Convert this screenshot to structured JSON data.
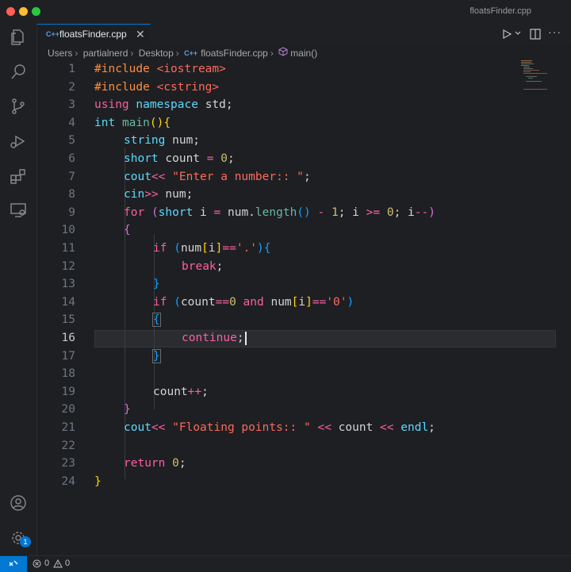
{
  "window": {
    "title": "floatsFinder.cpp"
  },
  "tab": {
    "icon_label": "C++",
    "name": "floatsFinder.cpp"
  },
  "breadcrumb": {
    "parts": [
      "Users",
      "partialnerd",
      "Desktop"
    ],
    "file_icon": "C++",
    "file": "floatsFinder.cpp",
    "symbol": "main()"
  },
  "editor": {
    "active_line": 16,
    "line_numbers": [
      "1",
      "2",
      "3",
      "4",
      "5",
      "6",
      "7",
      "8",
      "9",
      "10",
      "11",
      "12",
      "13",
      "14",
      "15",
      "16",
      "17",
      "18",
      "19",
      "20",
      "21",
      "22",
      "23",
      "24"
    ]
  },
  "code": {
    "l1": [
      "#include",
      " ",
      "<iostream>"
    ],
    "l2": [
      "#include",
      " ",
      "<cstring>"
    ],
    "l3": [
      "using",
      " ",
      "namespace",
      " std;"
    ],
    "l4": [
      "int",
      " ",
      "main",
      "()",
      "{"
    ],
    "l5": [
      "string",
      " num;"
    ],
    "l6": [
      "short",
      " count ",
      "=",
      " ",
      "0",
      ";"
    ],
    "l7": [
      "cout",
      "<<",
      " ",
      "\"Enter a number:: \"",
      ";"
    ],
    "l8": [
      "cin",
      ">>",
      " num;"
    ],
    "l9": [
      "for",
      " ",
      "(",
      "short",
      " i ",
      "=",
      " num.",
      "length",
      "()",
      " ",
      "-",
      " ",
      "1",
      "; i ",
      ">=",
      " ",
      "0",
      "; i",
      "--",
      ")"
    ],
    "l10": [
      "{"
    ],
    "l11": [
      "if",
      " ",
      "(",
      "num",
      "[",
      "i",
      "]",
      "==",
      "'.'",
      ")",
      "{"
    ],
    "l12": [
      "break",
      ";"
    ],
    "l13": [
      "}"
    ],
    "l14": [
      "if",
      " ",
      "(",
      "count",
      "==",
      "0",
      " ",
      "and",
      " num",
      "[",
      "i",
      "]",
      "==",
      "'0'",
      ")"
    ],
    "l15": [
      "{"
    ],
    "l16": [
      "continue",
      ";"
    ],
    "l17": [
      "}"
    ],
    "l19": [
      "count",
      "++",
      ";"
    ],
    "l20": [
      "}"
    ],
    "l21": [
      "cout",
      "<<",
      " ",
      "\"Floating points:: \"",
      " ",
      "<<",
      " count ",
      "<<",
      " ",
      "endl",
      ";"
    ],
    "l23": [
      "return",
      " ",
      "0",
      ";"
    ],
    "l24": [
      "}"
    ]
  },
  "activity": {
    "settings_badge": "1"
  },
  "status": {
    "errors": "0",
    "warnings": "0"
  },
  "colors": {
    "accent": "#0078d4",
    "keyword": "#fc5fa3",
    "type": "#5dd8ff",
    "string": "#fc6a5d",
    "number": "#d0bf69"
  }
}
